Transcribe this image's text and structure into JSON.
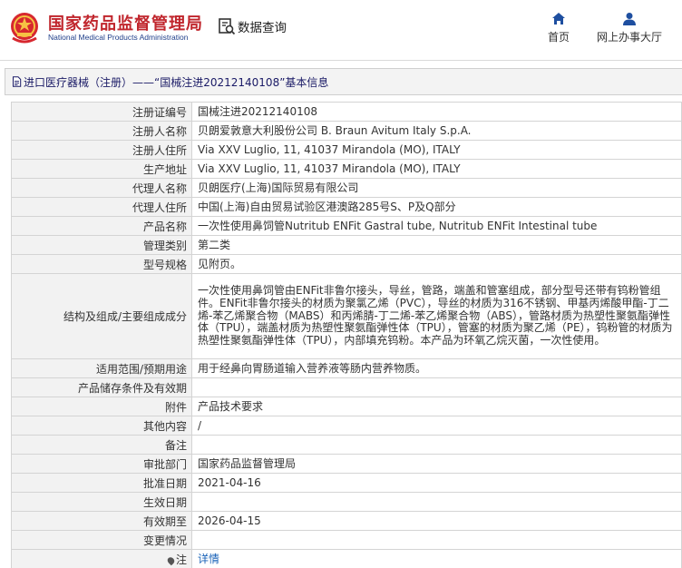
{
  "header": {
    "logo_cn": "国家药品监督管理局",
    "logo_en": "National Medical Products Administration",
    "data_search": "数据查询",
    "nav": [
      {
        "label": "首页",
        "icon": "home-icon"
      },
      {
        "label": "网上办事大厅",
        "icon": "user-icon"
      }
    ]
  },
  "breadcrumb": {
    "icon": "document-icon",
    "text": "进口医疗器械（注册）——“国械注进20212140108”基本信息"
  },
  "details": [
    {
      "label": "注册证编号",
      "value": "国械注进20212140108"
    },
    {
      "label": "注册人名称",
      "value": "贝朗爱敦意大利股份公司 B. Braun Avitum Italy S.p.A."
    },
    {
      "label": "注册人住所",
      "value": "Via XXV Luglio, 11, 41037 Mirandola (MO), ITALY"
    },
    {
      "label": "生产地址",
      "value": "Via XXV Luglio, 11, 41037 Mirandola (MO), ITALY"
    },
    {
      "label": "代理人名称",
      "value": "贝朗医疗(上海)国际贸易有限公司"
    },
    {
      "label": "代理人住所",
      "value": "中国(上海)自由贸易试验区港澳路285号S、P及Q部分"
    },
    {
      "label": "产品名称",
      "value": "一次性使用鼻饲管Nutritub ENFit Gastral tube, Nutritub ENFit Intestinal tube"
    },
    {
      "label": "管理类别",
      "value": "第二类"
    },
    {
      "label": "型号规格",
      "value": "见附页。"
    },
    {
      "label": "结构及组成/主要组成成分",
      "value": "一次性使用鼻饲管由ENFit非鲁尔接头，导丝，管路，端盖和管塞组成，部分型号还带有钨粉管组件。ENFit非鲁尔接头的材质为聚氯乙烯（PVC），导丝的材质为316不锈钢、甲基丙烯酸甲酯-丁二烯-苯乙烯聚合物（MABS）和丙烯腈-丁二烯-苯乙烯聚合物（ABS），管路材质为热塑性聚氨酯弹性体（TPU），端盖材质为热塑性聚氨酯弹性体（TPU），管塞的材质为聚乙烯（PE），钨粉管的材质为热塑性聚氨酯弹性体（TPU），内部填充钨粉。本产品为环氧乙烷灭菌，一次性使用。"
    },
    {
      "label": "适用范围/预期用途",
      "value": "用于经鼻向胃肠道输入营养液等肠内营养物质。"
    },
    {
      "label": "产品储存条件及有效期",
      "value": ""
    },
    {
      "label": "附件",
      "value": "产品技术要求"
    },
    {
      "label": "其他内容",
      "value": "/"
    },
    {
      "label": "备注",
      "value": ""
    },
    {
      "label": "审批部门",
      "value": "国家药品监督管理局"
    },
    {
      "label": "批准日期",
      "value": "2021-04-16"
    },
    {
      "label": "生效日期",
      "value": ""
    },
    {
      "label": "有效期至",
      "value": "2026-04-15"
    },
    {
      "label": "变更情况",
      "value": ""
    },
    {
      "label": "注",
      "value": "详情",
      "icon": "pin-icon"
    }
  ]
}
